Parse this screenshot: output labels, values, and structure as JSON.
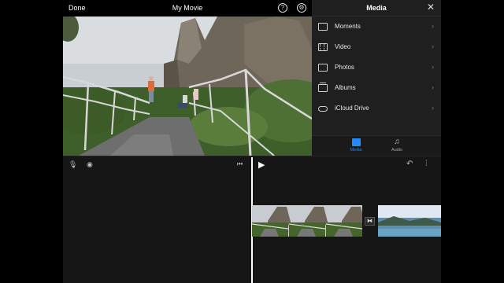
{
  "header": {
    "done_label": "Done",
    "title": "My Movie",
    "help_icon": "help-icon",
    "settings_icon": "settings-icon"
  },
  "media_panel": {
    "title": "Media",
    "close_icon": "close-icon",
    "items": [
      {
        "label": "Moments",
        "icon": "moments-icon"
      },
      {
        "label": "Video",
        "icon": "film-icon"
      },
      {
        "label": "Photos",
        "icon": "photo-icon"
      },
      {
        "label": "Albums",
        "icon": "albums-icon"
      },
      {
        "label": "iCloud Drive",
        "icon": "cloud-icon"
      }
    ],
    "tabs": [
      {
        "label": "Media",
        "icon": "media-tab-icon",
        "active": true
      },
      {
        "label": "Audio",
        "icon": "music-note-icon",
        "active": false
      }
    ]
  },
  "timeline": {
    "tools": [
      "mic-icon",
      "camera-icon",
      "skip-back-icon",
      "play-icon",
      "undo-icon",
      "waveform-icon"
    ]
  },
  "colors": {
    "accent": "#1f8bff",
    "background": "#161616",
    "panel": "#1f1f1f"
  }
}
